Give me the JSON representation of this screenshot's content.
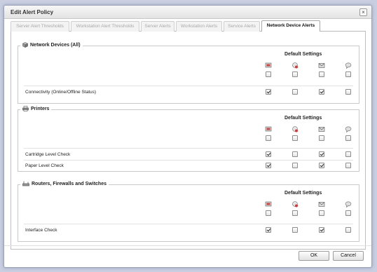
{
  "window": {
    "title": "Edit Alert Policy",
    "close_glyph": "×"
  },
  "tabs": [
    {
      "label": "Server Alert Thresholds",
      "active": false
    },
    {
      "label": "Workstation Alert Thresholds",
      "active": false
    },
    {
      "label": "Server Alerts",
      "active": false
    },
    {
      "label": "Workstation Alerts",
      "active": false
    },
    {
      "label": "Service Alerts",
      "active": false
    },
    {
      "label": "Network Device Alerts",
      "active": true
    }
  ],
  "sections": [
    {
      "title": "Network Devices (All)",
      "icon": "network-device-icon",
      "default_settings_label": "Default Settings",
      "default_row": [
        false,
        false,
        false,
        false
      ],
      "rows": [
        {
          "label": "Connectivity (Online/Offline Status)",
          "checks": [
            true,
            false,
            true,
            false
          ]
        }
      ]
    },
    {
      "title": "Printers",
      "icon": "printer-icon",
      "default_settings_label": "Default Settings",
      "default_row": [
        false,
        false,
        false,
        false
      ],
      "rows": [
        {
          "label": "Cartridge Level Check",
          "checks": [
            true,
            false,
            true,
            false
          ]
        },
        {
          "label": "Paper Level Check",
          "checks": [
            true,
            false,
            true,
            false
          ]
        }
      ]
    },
    {
      "title": "Routers, Firewalls and Switches",
      "icon": "router-icon",
      "default_settings_label": "Default Settings",
      "default_row": [
        false,
        false,
        false,
        false
      ],
      "rows": [
        {
          "label": "Interface Check",
          "checks": [
            true,
            false,
            true,
            false
          ]
        }
      ]
    }
  ],
  "column_icons": [
    "ticket-icon",
    "alert-ticket-icon",
    "email-icon",
    "sms-icon"
  ],
  "colors": {
    "accent": "#4a6fb0",
    "tab_inactive_text": "#a8a8a8",
    "border": "#c9c9c9"
  },
  "buttons": {
    "ok": "OK",
    "cancel": "Cancel"
  }
}
